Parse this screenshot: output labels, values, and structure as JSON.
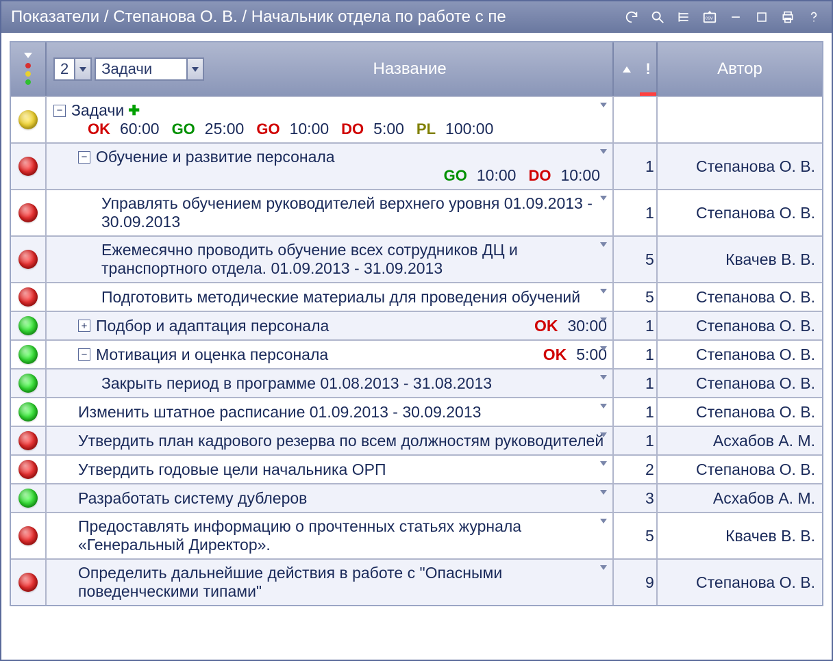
{
  "titlebar": {
    "text": "Показатели / Степанова О. В. / Начальник отдела по работе с пе"
  },
  "header": {
    "level_value": "2",
    "type_value": "Задачи",
    "name_label": "Название",
    "author_label": "Автор",
    "priority_symbol": "!"
  },
  "rows": [
    {
      "status": "yellow",
      "indent": 0,
      "toggle": "minus",
      "text": "Задачи",
      "add_plus": true,
      "stats_main": [
        {
          "code": "OK",
          "color": "red",
          "time": "60:00"
        },
        {
          "code": "GO",
          "color": "green",
          "time": "25:00"
        },
        {
          "code": "GO",
          "color": "red",
          "time": "10:00"
        },
        {
          "code": "DO",
          "color": "red",
          "time": "5:00"
        },
        {
          "code": "PL",
          "color": "olive",
          "time": "100:00"
        }
      ],
      "priority": "",
      "author": ""
    },
    {
      "status": "red",
      "indent": 1,
      "toggle": "minus",
      "text": "Обучение и развитие персонала",
      "stats_sub": [
        {
          "code": "GO",
          "color": "green",
          "time": "10:00"
        },
        {
          "code": "DO",
          "color": "red",
          "time": "10:00"
        }
      ],
      "priority": "1",
      "author": "Степанова О. В."
    },
    {
      "status": "red",
      "indent": 2,
      "toggle": null,
      "text": "Управлять обучением руководителей верхнего уровня 01.09.2013 - 30.09.2013",
      "priority": "1",
      "author": "Степанова О. В."
    },
    {
      "status": "red",
      "indent": 2,
      "toggle": null,
      "text": "Ежемесячно проводить обучение всех сотрудников ДЦ и транспортного отдела. 01.09.2013 - 31.09.2013",
      "priority": "5",
      "author": "Квачев В. В."
    },
    {
      "status": "red",
      "indent": 2,
      "toggle": null,
      "text": "Подготовить методические материалы для проведения обучений",
      "priority": "5",
      "author": "Степанова О. В."
    },
    {
      "status": "green",
      "indent": 1,
      "toggle": "plus",
      "text": "Подбор и адаптация персонала",
      "inline_stats": [
        {
          "code": "OK",
          "color": "red",
          "time": "30:00"
        }
      ],
      "priority": "1",
      "author": "Степанова О. В."
    },
    {
      "status": "green",
      "indent": 1,
      "toggle": "minus",
      "text": "Мотивация и оценка персонала",
      "inline_stats": [
        {
          "code": "OK",
          "color": "red",
          "time": "5:00"
        }
      ],
      "priority": "1",
      "author": "Степанова О. В."
    },
    {
      "status": "green",
      "indent": 2,
      "toggle": null,
      "text": "Закрыть период в программе 01.08.2013 - 31.08.2013",
      "priority": "1",
      "author": "Степанова О. В."
    },
    {
      "status": "green",
      "indent": 1,
      "toggle": null,
      "text": "Изменить штатное расписание 01.09.2013 - 30.09.2013",
      "priority": "1",
      "author": "Степанова О. В."
    },
    {
      "status": "red",
      "indent": 1,
      "toggle": null,
      "text": "Утвердить план кадрового резерва по всем должностям руководителей",
      "priority": "1",
      "author": "Асхабов А. М."
    },
    {
      "status": "red",
      "indent": 1,
      "toggle": null,
      "text": "Утвердить годовые цели начальника ОРП",
      "priority": "2",
      "author": "Степанова О. В."
    },
    {
      "status": "green",
      "indent": 1,
      "toggle": null,
      "text": "Разработать систему дублеров",
      "priority": "3",
      "author": "Асхабов А. М."
    },
    {
      "status": "red",
      "indent": 1,
      "toggle": null,
      "text": "Предоставлять информацию о прочтенных статьях журнала «Генеральный Директор».",
      "priority": "5",
      "author": "Квачев В. В."
    },
    {
      "status": "red",
      "indent": 1,
      "toggle": null,
      "text": "Определить дальнейшие действия в работе с \"Опасными поведенческими типами\"",
      "priority": "9",
      "author": "Степанова О. В."
    }
  ]
}
